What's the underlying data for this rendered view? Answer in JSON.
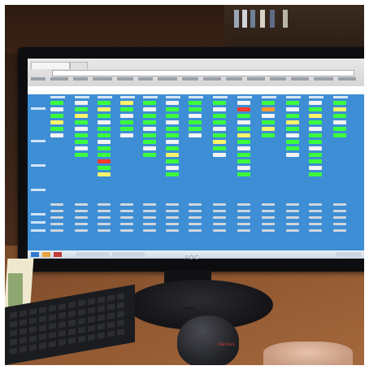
{
  "image": {
    "monitor_brand": "AOC",
    "mouse_logo": "Genius"
  }
}
